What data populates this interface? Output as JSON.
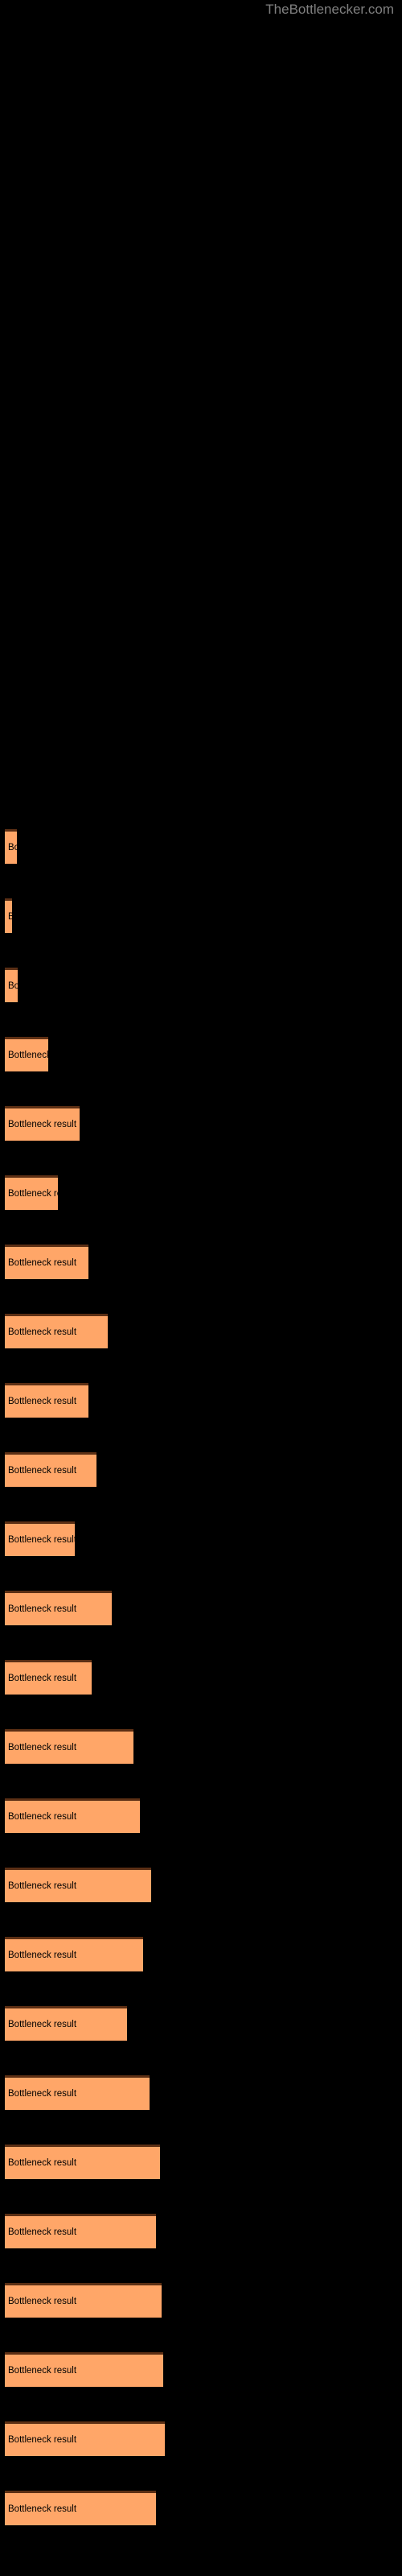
{
  "header": {
    "site_title": "TheBottlenecker.com"
  },
  "chart_data": {
    "type": "bar",
    "title": "",
    "subtitle": "",
    "xlabel": "",
    "ylabel": "",
    "orientation": "horizontal",
    "grid": false,
    "legend": null,
    "bar_color": "#ffa668",
    "bar_border_color": "#5c2f14",
    "background_color": "#000000",
    "label_color": "#000000",
    "title_color": "#808080",
    "xlim": [
      0,
      500
    ],
    "bar_label_text": "Bottleneck result",
    "categories": [
      "Bottleneck result",
      "Bottleneck result",
      "Bottleneck result",
      "Bottleneck result",
      "Bottleneck result",
      "Bottleneck result",
      "Bottleneck result",
      "Bottleneck result",
      "Bottleneck result",
      "Bottleneck result",
      "Bottleneck result",
      "Bottleneck result",
      "Bottleneck result",
      "Bottleneck result",
      "Bottleneck result",
      "Bottleneck result",
      "Bottleneck result",
      "Bottleneck result",
      "Bottleneck result",
      "Bottleneck result",
      "Bottleneck result",
      "Bottleneck result",
      "Bottleneck result",
      "Bottleneck result",
      "Bottleneck result"
    ],
    "values": [
      15,
      9,
      16,
      54,
      93,
      66,
      104,
      128,
      104,
      114,
      87,
      133,
      108,
      160,
      168,
      182,
      172,
      152,
      180,
      193,
      188,
      195,
      197,
      199,
      188
    ],
    "bars": [
      {
        "label": "Bottleneck result",
        "value": 15,
        "top": 1030
      },
      {
        "label": "Bottleneck result",
        "value": 9,
        "top": 1116
      },
      {
        "label": "Bottleneck result",
        "value": 16,
        "top": 1202
      },
      {
        "label": "Bottleneck result",
        "value": 54,
        "top": 1288
      },
      {
        "label": "Bottleneck result",
        "value": 93,
        "top": 1374
      },
      {
        "label": "Bottleneck result",
        "value": 66,
        "top": 1460
      },
      {
        "label": "Bottleneck result",
        "value": 104,
        "top": 1546
      },
      {
        "label": "Bottleneck result",
        "value": 128,
        "top": 1632
      },
      {
        "label": "Bottleneck result",
        "value": 104,
        "top": 1718
      },
      {
        "label": "Bottleneck result",
        "value": 114,
        "top": 1804
      },
      {
        "label": "Bottleneck result",
        "value": 87,
        "top": 1890
      },
      {
        "label": "Bottleneck result",
        "value": 133,
        "top": 1976
      },
      {
        "label": "Bottleneck result",
        "value": 108,
        "top": 2062
      },
      {
        "label": "Bottleneck result",
        "value": 160,
        "top": 2148
      },
      {
        "label": "Bottleneck result",
        "value": 168,
        "top": 2234
      },
      {
        "label": "Bottleneck result",
        "value": 182,
        "top": 2320
      },
      {
        "label": "Bottleneck result",
        "value": 172,
        "top": 2406
      },
      {
        "label": "Bottleneck result",
        "value": 152,
        "top": 2492
      },
      {
        "label": "Bottleneck result",
        "value": 180,
        "top": 2578
      },
      {
        "label": "Bottleneck result",
        "value": 193,
        "top": 2664
      },
      {
        "label": "Bottleneck result",
        "value": 188,
        "top": 2750
      },
      {
        "label": "Bottleneck result",
        "value": 195,
        "top": 2836
      },
      {
        "label": "Bottleneck result",
        "value": 197,
        "top": 2922
      },
      {
        "label": "Bottleneck result",
        "value": 199,
        "top": 3008
      },
      {
        "label": "Bottleneck result",
        "value": 188,
        "top": 3094
      }
    ]
  }
}
